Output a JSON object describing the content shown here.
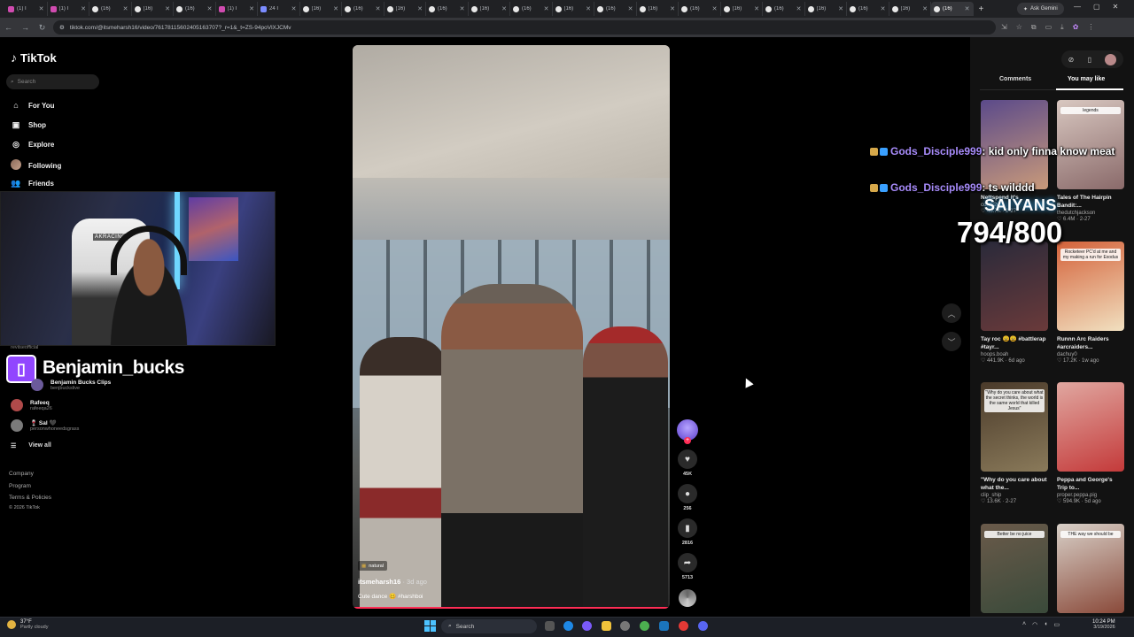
{
  "browser": {
    "tabs": [
      {
        "label": "(1) I",
        "kind": "ig"
      },
      {
        "label": "(1) I",
        "kind": "ig"
      },
      {
        "label": "(16)",
        "kind": "tt"
      },
      {
        "label": "(16)",
        "kind": "tt"
      },
      {
        "label": "(16)",
        "kind": "tt"
      },
      {
        "label": "(1) I",
        "kind": "ig"
      },
      {
        "label": "24 I",
        "kind": "fb"
      },
      {
        "label": "(16)",
        "kind": "tt"
      },
      {
        "label": "(16)",
        "kind": "tt"
      },
      {
        "label": "(16)",
        "kind": "tt"
      },
      {
        "label": "(16)",
        "kind": "tt"
      },
      {
        "label": "(16)",
        "kind": "tt"
      },
      {
        "label": "(16)",
        "kind": "tt"
      },
      {
        "label": "(16)",
        "kind": "tt"
      },
      {
        "label": "(16)",
        "kind": "tt"
      },
      {
        "label": "(16)",
        "kind": "tt"
      },
      {
        "label": "(16)",
        "kind": "tt"
      },
      {
        "label": "(16)",
        "kind": "tt"
      },
      {
        "label": "(16)",
        "kind": "tt"
      },
      {
        "label": "(16)",
        "kind": "tt"
      },
      {
        "label": "(16)",
        "kind": "tt"
      },
      {
        "label": "(16)",
        "kind": "tt"
      },
      {
        "label": "(16)",
        "kind": "active"
      }
    ],
    "gemini_label": "Ask Gemini",
    "url": "tiktok.com/@itsmeharsh16/video/7617811560240516370​7?_r=1&_t=ZS-94poVlXJCMv"
  },
  "sidebar": {
    "logo": "TikTok",
    "search_placeholder": "Search",
    "nav": [
      {
        "label": "For You",
        "icon": "home-icon",
        "glyph": "⌂"
      },
      {
        "label": "Shop",
        "icon": "shop-icon",
        "glyph": "▣"
      },
      {
        "label": "Explore",
        "icon": "compass-icon",
        "glyph": "◎"
      },
      {
        "label": "Following",
        "icon": "following-avatar-icon",
        "glyph": ""
      },
      {
        "label": "Friends",
        "icon": "friends-icon",
        "glyph": "👥"
      }
    ],
    "accounts": [
      {
        "name": "Benjamin Bucks Clips",
        "handle": "benjbuckslive",
        "color": "#6b5a9a"
      },
      {
        "name": "Rafeeq",
        "handle": "rafeeqa26",
        "color": "#b04a4a"
      },
      {
        "name": "🍷 Sal 🖤",
        "handle": "personwhoneedsgrass",
        "color": "#7a7a7a"
      }
    ],
    "partial_account": "reviiseofficial",
    "view_all": "View all",
    "footer": [
      "Company",
      "Program",
      "Terms & Policies",
      "© 2026 TikTok"
    ]
  },
  "webcam": {
    "chair_label": "AKRACING"
  },
  "twitch": {
    "glyph": "▯",
    "name": "Benjamin_bucks"
  },
  "video": {
    "tag": "natural",
    "username": "itsmeharsh16",
    "ago": " · 3d ago",
    "caption": "Cute dance 🥴 #harshboi",
    "progress_fraction": 1.0
  },
  "actions": {
    "likes": "45K",
    "comments": "256",
    "saves": "2816",
    "shares": "5713"
  },
  "panel": {
    "tab_comments": "Comments",
    "tab_you_may_like": "You may like",
    "cards": [
      {
        "title": "Nettspend it's",
        "author": "corey2u",
        "stats": "♡ 40.7K · 2-27",
        "thumb_text": "",
        "c1": "#5b4a8a",
        "c2": "#c99a7a"
      },
      {
        "title": "Tales of The Hairpin Bandit:...",
        "author": "thedutchjackson",
        "stats": "♡ 6.4M · 2-27",
        "thumb_text": "legends",
        "c1": "#d8c7c0",
        "c2": "#8a6a6a"
      },
      {
        "title": "Tay roc 😩😩 #battlerap #tayr...",
        "author": "hoops.boah",
        "stats": "♡ 441.9K · 6d ago",
        "thumb_text": "",
        "c1": "#2a2a3a",
        "c2": "#6a3a3a"
      },
      {
        "title": "Runnn Arc Raiders #arcraiders...",
        "author": "dachuy0",
        "stats": "♡ 17.2K · 1w ago",
        "thumb_text": "Rocketeer PC'd at me and my making a run for Exodus",
        "c1": "#d4623a",
        "c2": "#f1e0c0"
      },
      {
        "title": "\"Why do you care about what the...",
        "author": "clip_ship",
        "stats": "♡ 13.6K · 2-27",
        "thumb_text": "\"Why do you care about what the secret thinks, the world is the same world that killed Jesus\"",
        "c1": "#4a3a2a",
        "c2": "#8a7a5a"
      },
      {
        "title": "Peppa and George's Trip to...",
        "author": "proper.peppa.pig",
        "stats": "♡ 594.9K · 5d ago",
        "thumb_text": "",
        "c1": "#e0a7a0",
        "c2": "#c43a3a"
      },
      {
        "title": "",
        "author": "",
        "stats": "",
        "thumb_text": "Better be no juice",
        "c1": "#6a5a4a",
        "c2": "#3a4a3a"
      },
      {
        "title": "",
        "author": "",
        "stats": "",
        "thumb_text": "THE way we should be",
        "c1": "#d8d0c8",
        "c2": "#8a4a3a"
      }
    ]
  },
  "chat": {
    "line1_user": "Gods_Disciple999",
    "line1_msg": ": kid only finna know meat",
    "line2_user": "Gods_Disciple999",
    "line2_msg": ": ts wilddd"
  },
  "overlay": {
    "team": "SAIYANS",
    "goal_text": "794/800",
    "goal_current": 794,
    "goal_target": 800
  },
  "taskbar": {
    "temp": "37°F",
    "weather": "Partly cloudy",
    "search": "Search",
    "time": "10:24 PM",
    "date": "3/19/2026"
  },
  "colors": {
    "accent": "#ff2d55",
    "twitch": "#9146ff",
    "chat_user": "#a78bfa"
  }
}
